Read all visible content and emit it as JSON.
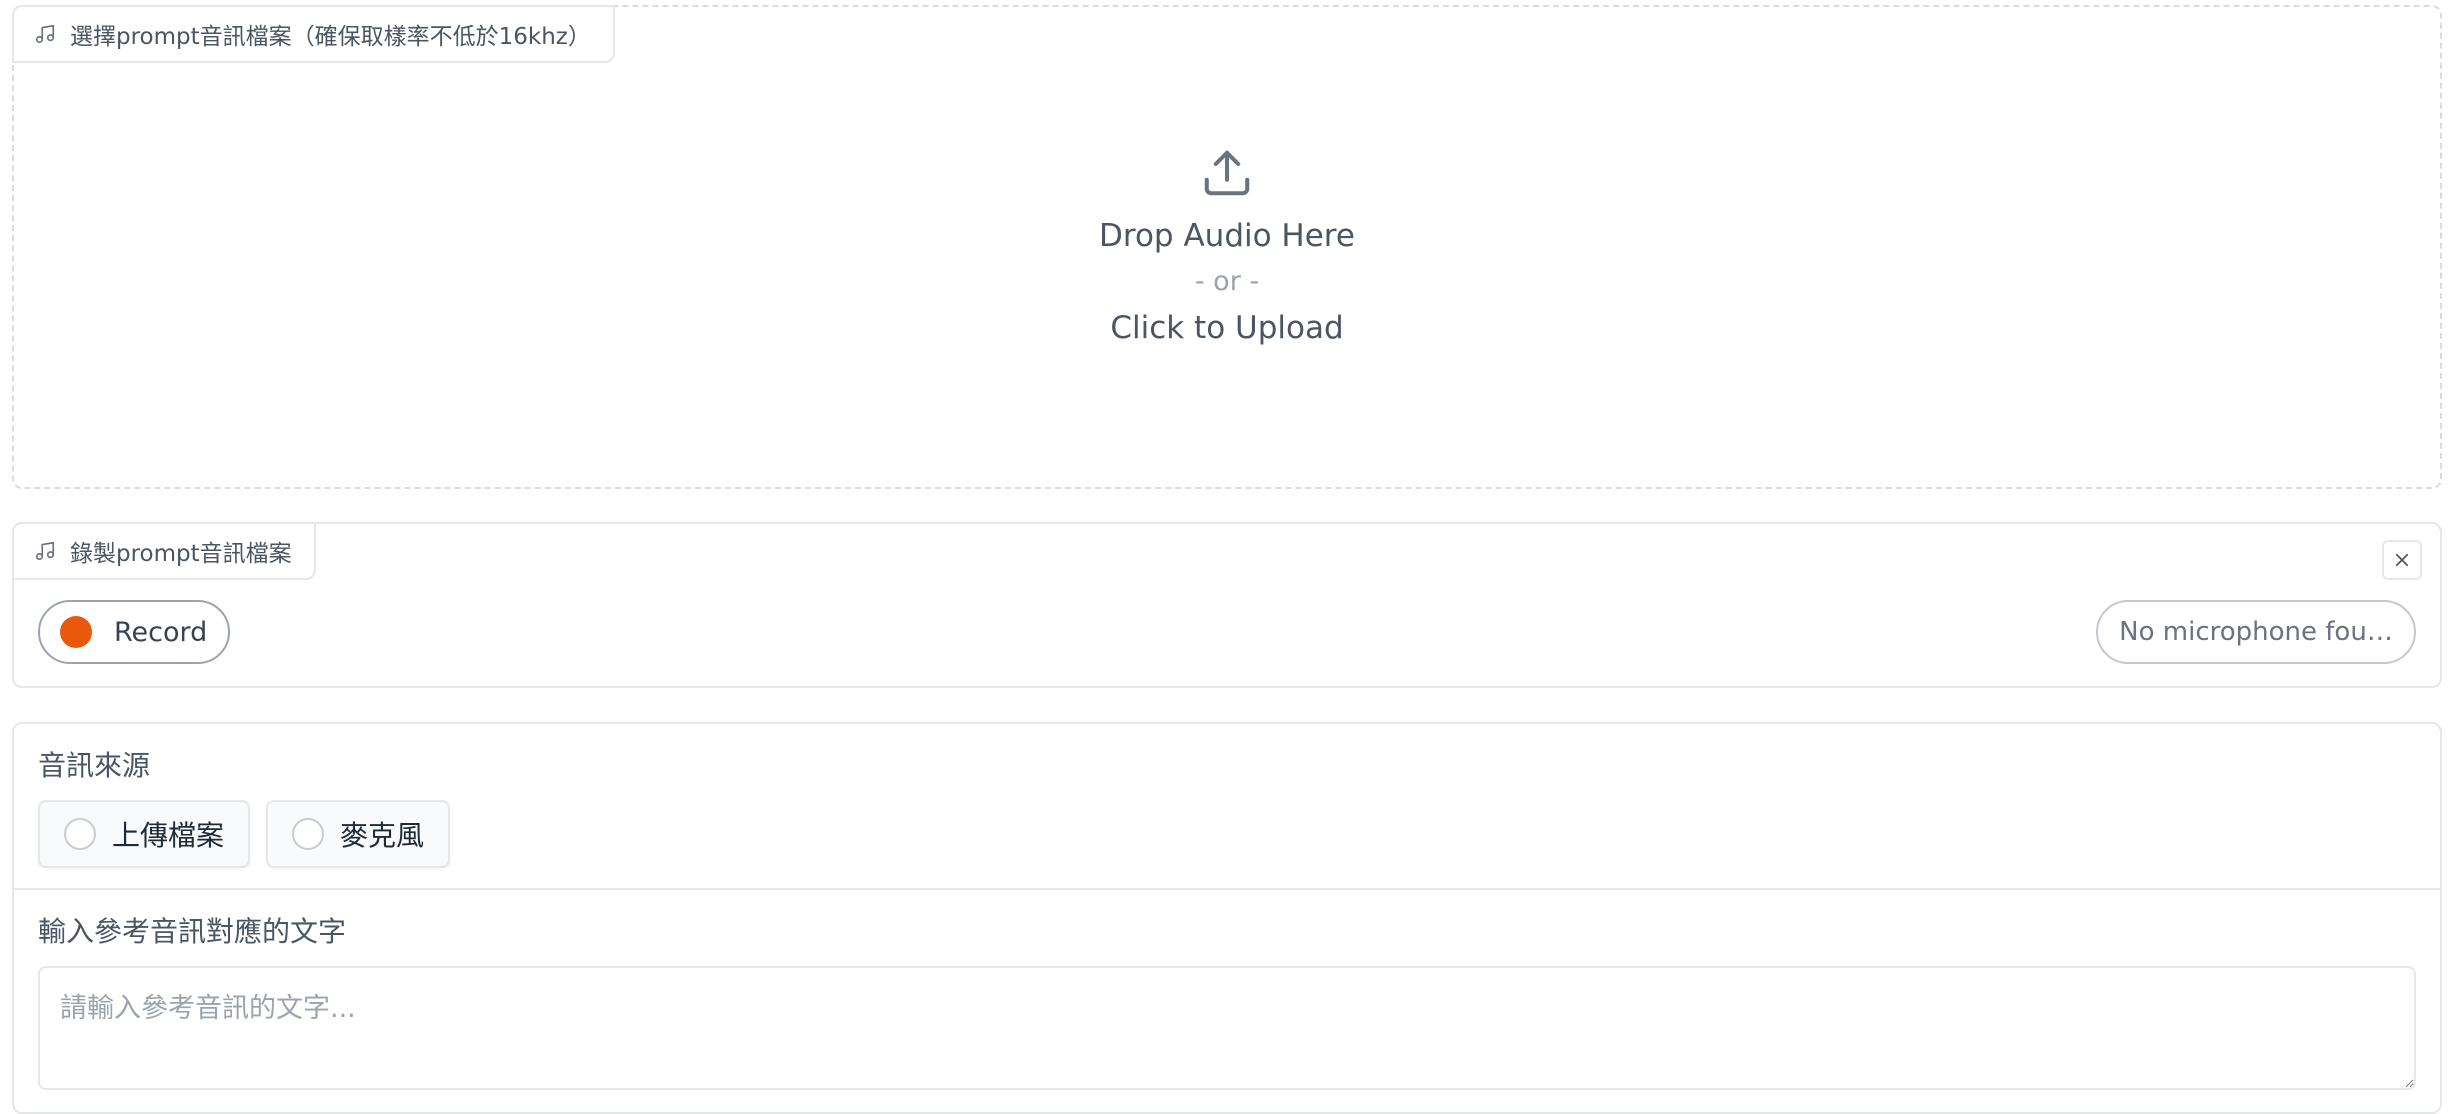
{
  "upload_panel": {
    "label": "選擇prompt音訊檔案（確保取樣率不低於16khz）",
    "icon": "music-note-icon",
    "drop_text": "Drop Audio Here",
    "or_text": "- or -",
    "click_text": "Click to Upload",
    "upload_icon": "upload-icon"
  },
  "record_panel": {
    "label": "錄製prompt音訊檔案",
    "icon": "music-note-icon",
    "record_label": "Record",
    "record_color": "#ea580c",
    "mic_select_label": "No microphone fou…",
    "close_icon": "close-icon"
  },
  "source_panel": {
    "title": "音訊來源",
    "options": [
      {
        "label": "上傳檔案",
        "selected": false
      },
      {
        "label": "麥克風",
        "selected": false
      }
    ],
    "text_title": "輸入參考音訊對應的文字",
    "text_placeholder": "請輸入參考音訊的文字..."
  }
}
